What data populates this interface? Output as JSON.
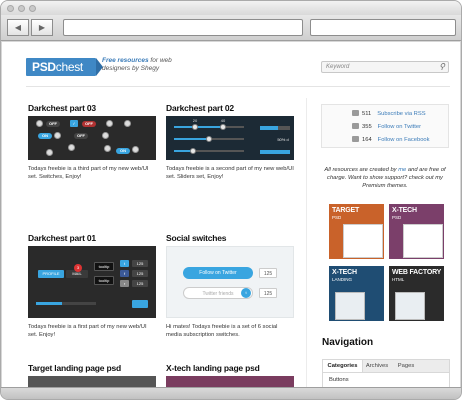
{
  "brand": {
    "logo_bold": "PSD",
    "logo_light": "chest",
    "tagline_lead": "Free resources",
    "tagline_rest": " for web designers by Shegy"
  },
  "search": {
    "placeholder": "Keyword"
  },
  "posts": [
    {
      "title": "Darkchest part 03",
      "excerpt": "Todays freebie is a third part of my new web/UI set. Switches, Enjoy!"
    },
    {
      "title": "Darkchest part 02",
      "excerpt": "Todays freebie is a second part of my new web/UI set. Sliders set, Enjoy!"
    },
    {
      "title": "Darkchest part 01",
      "excerpt": "Todays freebie is a first part of my new web/UI set. Enjoy!"
    },
    {
      "title": "Social switches",
      "excerpt": "Hi mates! Todays freebie is a set of 6 social media subscription switches."
    },
    {
      "title": "Target landing page psd",
      "excerpt": ""
    },
    {
      "title": "X-tech landing page psd",
      "excerpt": ""
    }
  ],
  "thumbs": {
    "switch_labels": {
      "off": "OFF",
      "on": "ON"
    },
    "slider_values": {
      "a": "20",
      "b": "40",
      "pct": "50% d"
    },
    "part01": {
      "profile": "PROFILE",
      "mail": "MAIL",
      "badge": "3",
      "tooltip": "tooltip",
      "count": "125"
    },
    "social": {
      "follow": "Follow on Twitter",
      "friends": "Twitter friends",
      "count": "125"
    }
  },
  "subscribe": [
    {
      "count": "511",
      "label": "Subscribe via RSS"
    },
    {
      "count": "355",
      "label": "Follow on Twitter"
    },
    {
      "count": "164",
      "label": "Follow on Facebook"
    }
  ],
  "credit": {
    "pre": "All resources are created by ",
    "me": "me",
    "post": " and are free of charge. Want to show support? check out my Premium themes."
  },
  "ads": [
    {
      "title": "TARGET",
      "sub": "PSD",
      "color": "#c9622a"
    },
    {
      "title": "X-TECH",
      "sub": "PSD",
      "color": "#7b3f6a"
    },
    {
      "title": "X-TECH",
      "sub": "LANDING",
      "color": "#1f4d73"
    },
    {
      "title": "WEB FACTORY",
      "sub": "HTML",
      "color": "#2b2b2b"
    }
  ],
  "navigation": {
    "title": "Navigation",
    "tabs": [
      "Categories",
      "Archives",
      "Pages"
    ],
    "active_item": "Buttons"
  }
}
